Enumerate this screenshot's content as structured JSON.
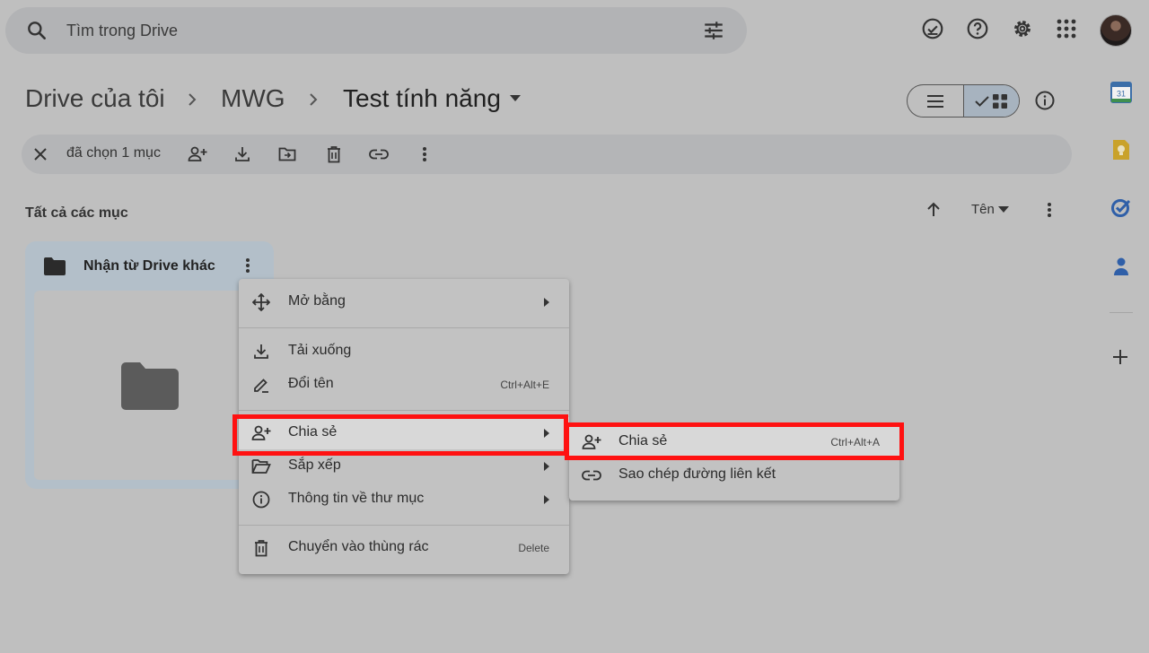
{
  "search": {
    "placeholder": "Tìm trong Drive"
  },
  "header_icons": [
    "offline-check-icon",
    "help-icon",
    "settings-icon",
    "apps-icon",
    "avatar"
  ],
  "breadcrumb": [
    "Drive của tôi",
    "MWG",
    "Test tính năng"
  ],
  "selection": {
    "count_label": "đã chọn 1 mục"
  },
  "section": {
    "title": "Tất cả các mục",
    "sort_label": "Tên"
  },
  "folder": {
    "name": "Nhận từ Drive khác"
  },
  "context_menu": {
    "open_with": "Mở bằng",
    "download": "Tải xuống",
    "rename": "Đổi tên",
    "rename_shortcut": "Ctrl+Alt+E",
    "share": "Chia sẻ",
    "organize": "Sắp xếp",
    "folder_info": "Thông tin về thư mục",
    "trash": "Chuyển vào thùng rác",
    "trash_shortcut": "Delete"
  },
  "share_submenu": {
    "share": "Chia sẻ",
    "share_shortcut": "Ctrl+Alt+A",
    "copy_link": "Sao chép đường liên kết"
  },
  "right_rail": {
    "calendar_day": "31",
    "items": [
      "calendar-icon",
      "keep-icon",
      "tasks-icon",
      "contacts-icon",
      "add-icon"
    ]
  },
  "colors": {
    "highlight_border": "#ff1111",
    "overlay_bg": "#bfbfbf"
  }
}
